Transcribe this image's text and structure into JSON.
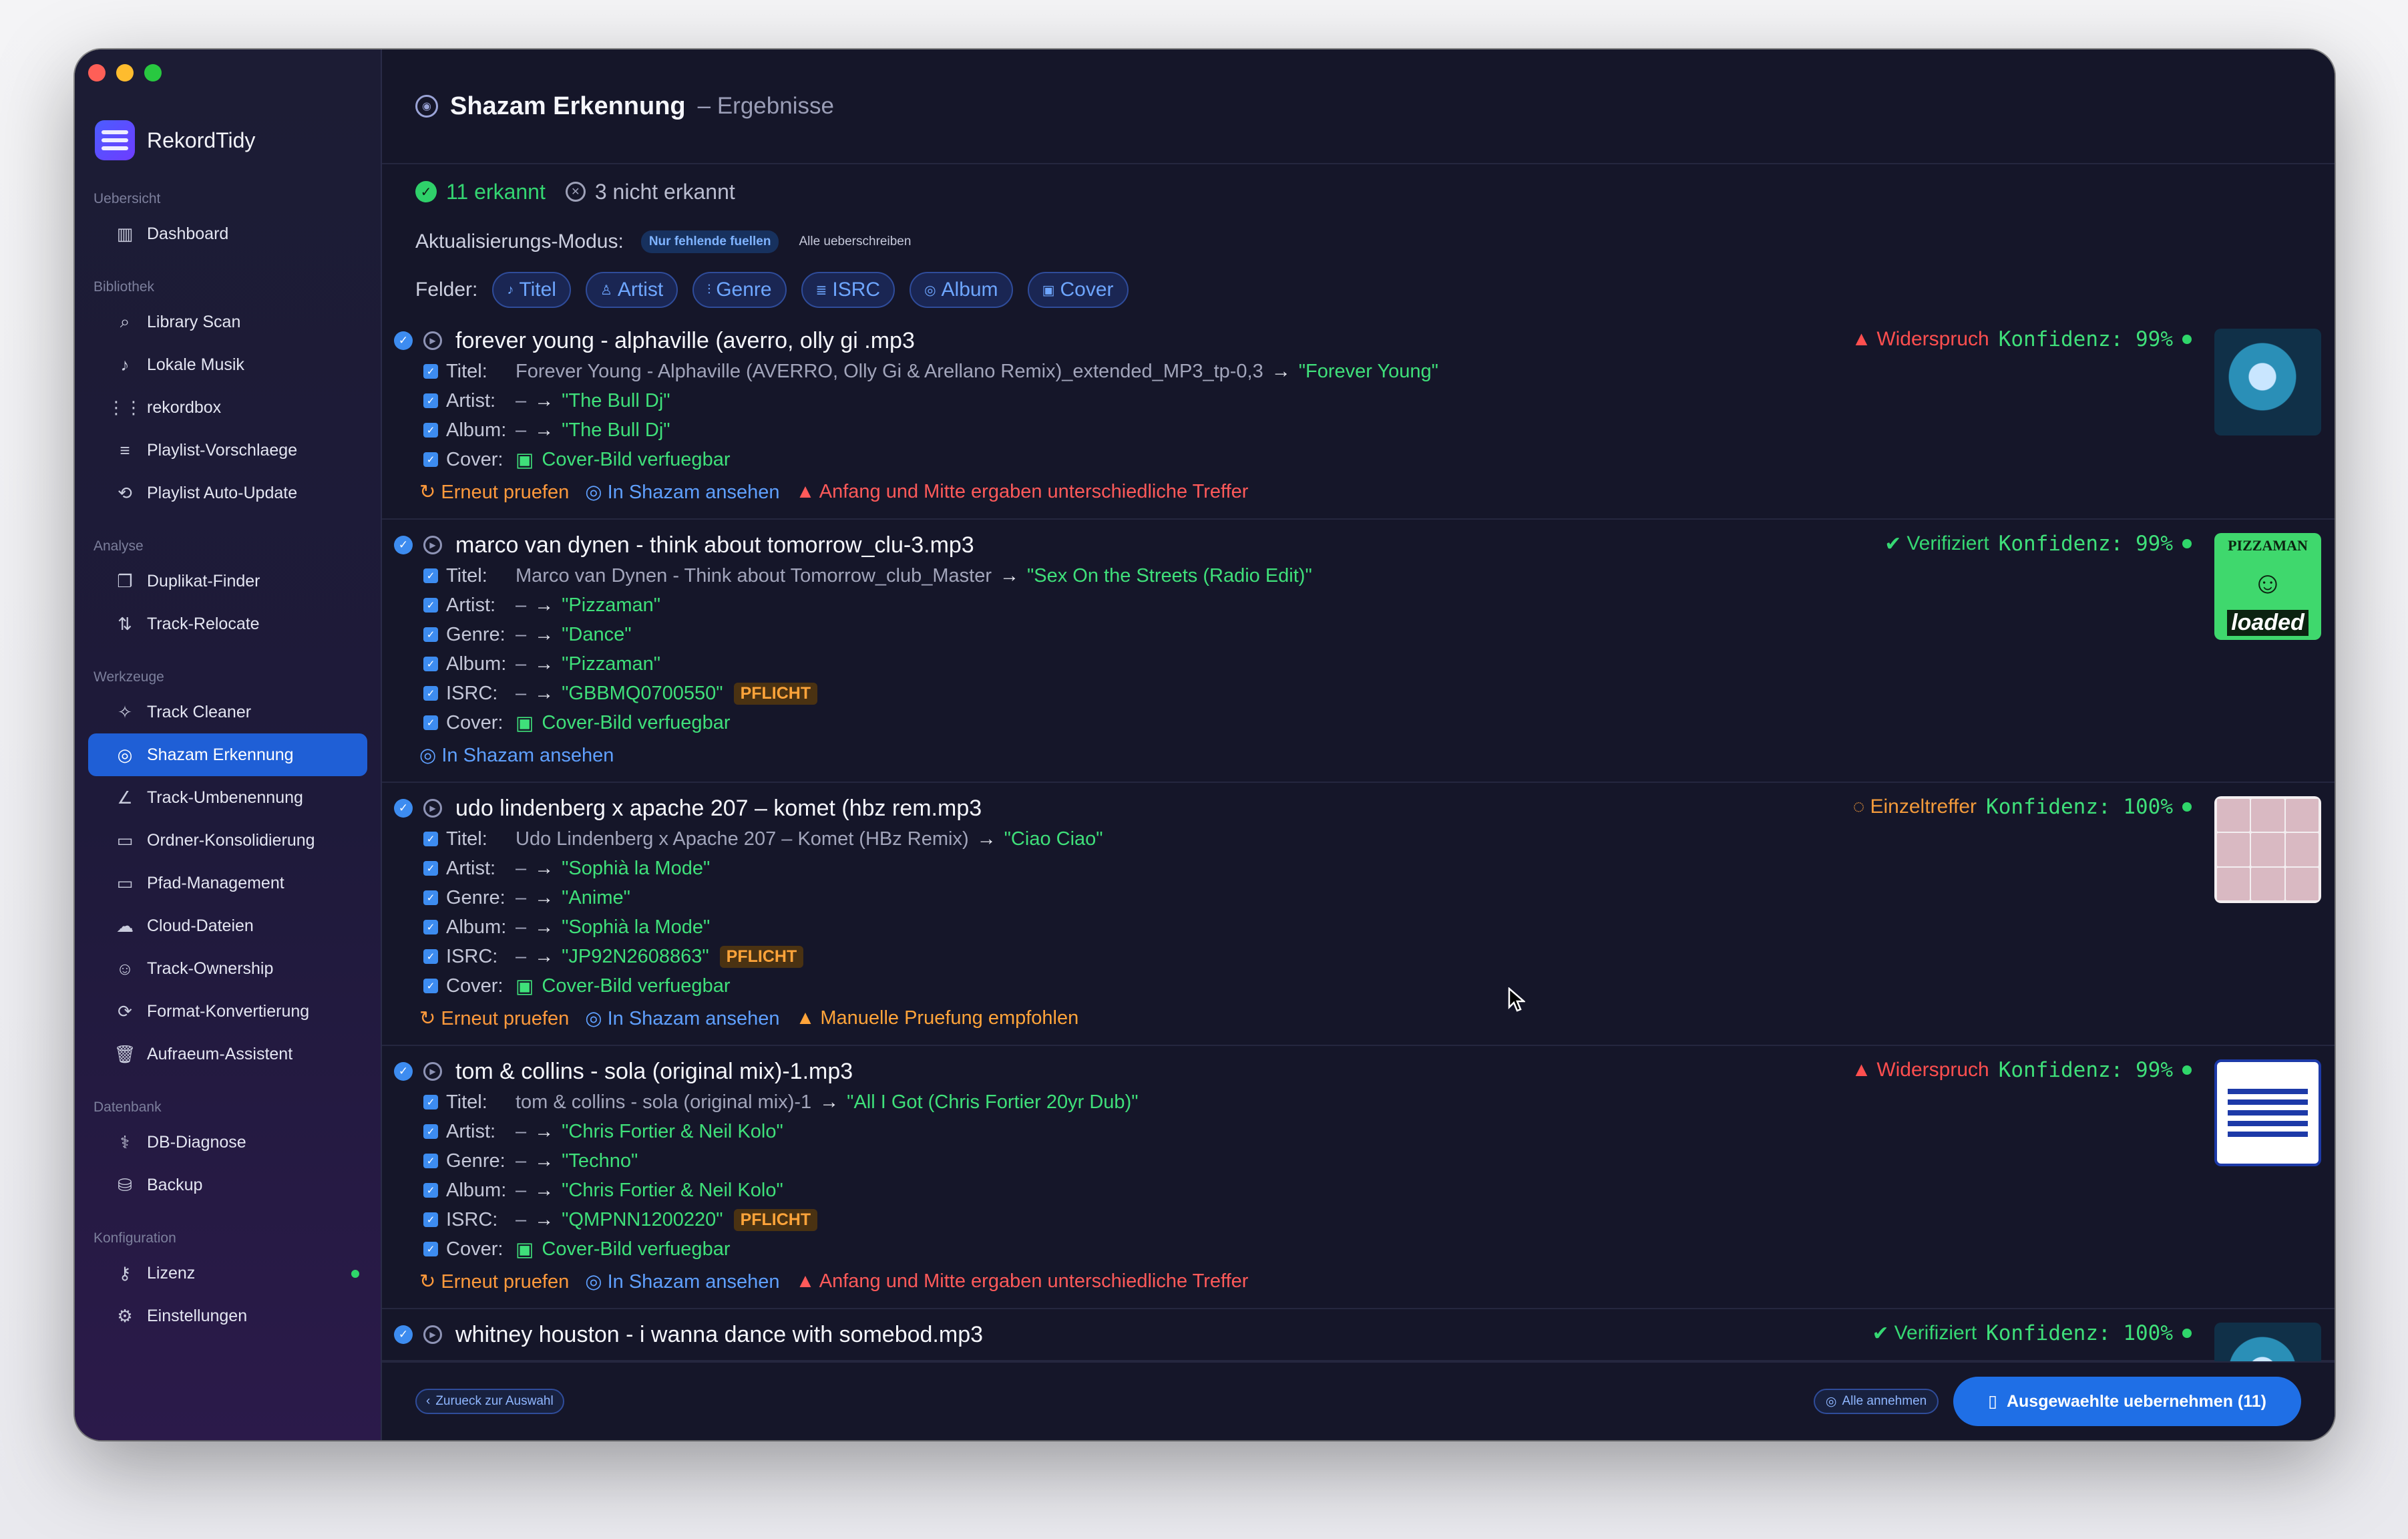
{
  "app": {
    "name": "RekordTidy"
  },
  "sidebar": {
    "sections": [
      {
        "title": "Uebersicht",
        "items": [
          {
            "label": "Dashboard",
            "icon": "chart-bar-icon"
          }
        ]
      },
      {
        "title": "Bibliothek",
        "items": [
          {
            "label": "Library Scan",
            "icon": "search-icon"
          },
          {
            "label": "Lokale Musik",
            "icon": "music-note-icon"
          },
          {
            "label": "rekordbox",
            "icon": "waveform-icon"
          },
          {
            "label": "Playlist-Vorschlaege",
            "icon": "playlist-icon"
          },
          {
            "label": "Playlist Auto-Update",
            "icon": "refresh-icon"
          }
        ]
      },
      {
        "title": "Analyse",
        "items": [
          {
            "label": "Duplikat-Finder",
            "icon": "duplicate-icon"
          },
          {
            "label": "Track-Relocate",
            "icon": "relocate-icon"
          }
        ]
      },
      {
        "title": "Werkzeuge",
        "items": [
          {
            "label": "Track Cleaner",
            "icon": "sparkle-icon"
          },
          {
            "label": "Shazam Erkennung",
            "icon": "shazam-icon"
          },
          {
            "label": "Track-Umbenennung",
            "icon": "pencil-icon"
          },
          {
            "label": "Ordner-Konsolidierung",
            "icon": "folder-icon"
          },
          {
            "label": "Pfad-Management",
            "icon": "folder-path-icon"
          },
          {
            "label": "Cloud-Dateien",
            "icon": "cloud-icon"
          },
          {
            "label": "Track-Ownership",
            "icon": "person-icon"
          },
          {
            "label": "Format-Konvertierung",
            "icon": "convert-icon"
          },
          {
            "label": "Aufraeum-Assistent",
            "icon": "trash-icon"
          }
        ]
      },
      {
        "title": "Datenbank",
        "items": [
          {
            "label": "DB-Diagnose",
            "icon": "stethoscope-icon"
          },
          {
            "label": "Backup",
            "icon": "backup-icon"
          }
        ]
      },
      {
        "title": "Konfiguration",
        "items": [
          {
            "label": "Lizenz",
            "icon": "key-icon"
          },
          {
            "label": "Einstellungen",
            "icon": "gear-icon"
          }
        ]
      }
    ],
    "active": "Shazam Erkennung"
  },
  "header": {
    "title": "Shazam Erkennung",
    "subtitle": "– Ergebnisse"
  },
  "stats": {
    "recognized": "11 erkannt",
    "not_recognized": "3 nicht erkannt"
  },
  "mode": {
    "label": "Aktualisierungs-Modus:",
    "active": "Nur fehlende fuellen",
    "other": "Alle ueberschreiben"
  },
  "fields": {
    "label": "Felder:",
    "chips": [
      "Titel",
      "Artist",
      "Genre",
      "ISRC",
      "Album",
      "Cover"
    ]
  },
  "tracks": [
    {
      "name": "forever young - alphaville (averro, olly gi .mp3",
      "status": "Widerspruch",
      "confidence": "Konfidenz: 99%",
      "rows": [
        {
          "label": "Titel:",
          "old": "Forever Young - Alphaville (AVERRO, Olly Gi & Arellano Remix)_extended_MP3_tp-0,3",
          "new": "\"Forever Young\""
        },
        {
          "label": "Artist:",
          "old": "–",
          "new": "\"The Bull Dj\""
        },
        {
          "label": "Album:",
          "old": "–",
          "new": "\"The Bull Dj\""
        }
      ],
      "cover": "Cover-Bild verfuegbar",
      "retry": "Erneut pruefen",
      "shazam": "In Shazam ansehen",
      "warning": "Anfang und Mitte ergaben unterschiedliche Treffer"
    },
    {
      "name": "marco van dynen - think about tomorrow_clu-3.mp3",
      "status": "Verifiziert",
      "confidence": "Konfidenz: 99%",
      "rows": [
        {
          "label": "Titel:",
          "old": "Marco van Dynen - Think about Tomorrow_club_Master",
          "new": "\"Sex On the Streets (Radio Edit)\""
        },
        {
          "label": "Artist:",
          "old": "–",
          "new": "\"Pizzaman\""
        },
        {
          "label": "Genre:",
          "old": "–",
          "new": "\"Dance\""
        },
        {
          "label": "Album:",
          "old": "–",
          "new": "\"Pizzaman\""
        },
        {
          "label": "ISRC:",
          "old": "–",
          "new": "\"GBBMQ0700550\"",
          "badge": "PFLICHT"
        }
      ],
      "cover": "Cover-Bild verfuegbar",
      "shazam": "In Shazam ansehen",
      "cover_text": "PIZZAMAN",
      "cover_sub": "loaded"
    },
    {
      "name": "udo lindenberg x apache 207 – komet (hbz rem.mp3",
      "status": "Einzeltreffer",
      "confidence": "Konfidenz: 100%",
      "rows": [
        {
          "label": "Titel:",
          "old": "Udo Lindenberg x Apache 207 – Komet (HBz Remix)",
          "new": "\"Ciao Ciao\""
        },
        {
          "label": "Artist:",
          "old": "–",
          "new": "\"Sophià la Mode\""
        },
        {
          "label": "Genre:",
          "old": "–",
          "new": "\"Anime\""
        },
        {
          "label": "Album:",
          "old": "–",
          "new": "\"Sophià la Mode\""
        },
        {
          "label": "ISRC:",
          "old": "–",
          "new": "\"JP92N2608863\"",
          "badge": "PFLICHT"
        }
      ],
      "cover": "Cover-Bild verfuegbar",
      "retry": "Erneut pruefen",
      "shazam": "In Shazam ansehen",
      "warning": "Manuelle Pruefung empfohlen"
    },
    {
      "name": "tom & collins - sola (original mix)-1.mp3",
      "status": "Widerspruch",
      "confidence": "Konfidenz: 99%",
      "rows": [
        {
          "label": "Titel:",
          "old": "tom & collins - sola (original mix)-1",
          "new": "\"All I Got (Chris Fortier 20yr Dub)\""
        },
        {
          "label": "Artist:",
          "old": "–",
          "new": "\"Chris Fortier & Neil Kolo\""
        },
        {
          "label": "Genre:",
          "old": "–",
          "new": "\"Techno\""
        },
        {
          "label": "Album:",
          "old": "–",
          "new": "\"Chris Fortier & Neil Kolo\""
        },
        {
          "label": "ISRC:",
          "old": "–",
          "new": "\"QMPNN1200220\"",
          "badge": "PFLICHT"
        }
      ],
      "cover": "Cover-Bild verfuegbar",
      "retry": "Erneut pruefen",
      "shazam": "In Shazam ansehen",
      "warning": "Anfang und Mitte ergaben unterschiedliche Treffer"
    },
    {
      "name": "whitney houston - i wanna dance with somebod.mp3",
      "status": "Verifiziert",
      "confidence": "Konfidenz: 100%"
    }
  ],
  "cover_label": "Cover:",
  "footer": {
    "back": "Zurueck zur Auswahl",
    "accept_all": "Alle annehmen",
    "apply": "Ausgewaehlte uebernehmen (11)"
  },
  "colors": {
    "accent": "#1f6fe6",
    "success": "#3fe07a",
    "danger": "#ff4f4f",
    "warning": "#ffa43a"
  }
}
